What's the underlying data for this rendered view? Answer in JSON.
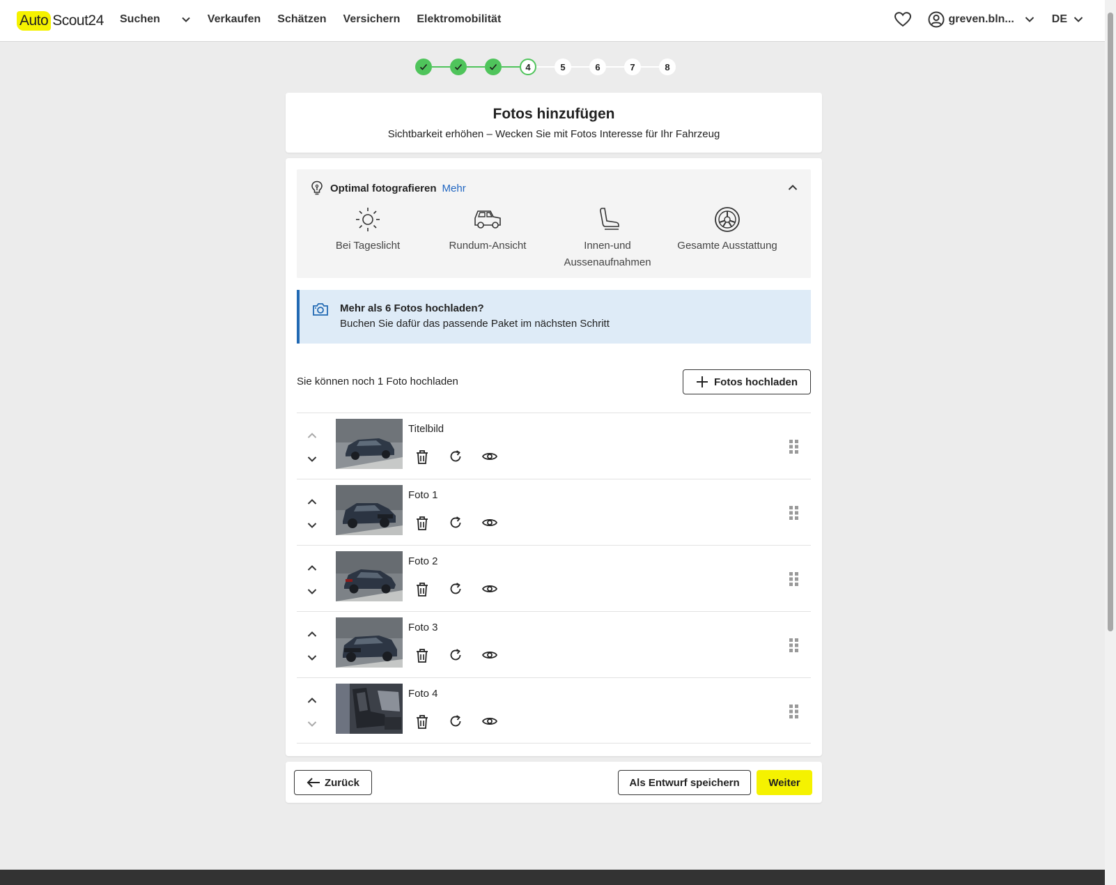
{
  "header": {
    "logo_auto": "Auto",
    "logo_scout": "Scout24",
    "nav": [
      "Suchen",
      "Verkaufen",
      "Schätzen",
      "Versichern",
      "Elektromobilität"
    ],
    "user": "greven.bln...",
    "language": "DE"
  },
  "stepper": {
    "steps": [
      "1",
      "2",
      "3",
      "4",
      "5",
      "6",
      "7",
      "8"
    ],
    "completed_count": 3,
    "current": 4
  },
  "title_card": {
    "title": "Fotos hinzufügen",
    "subtitle": "Sichtbarkeit erhöhen – Wecken Sie mit Fotos Interesse für Ihr Fahrzeug"
  },
  "tips": {
    "heading": "Optimal fotografieren",
    "more_link": "Mehr",
    "items": [
      {
        "icon": "sun-icon",
        "label": "Bei Tageslicht"
      },
      {
        "icon": "car-side-icon",
        "label": "Rundum-Ansicht"
      },
      {
        "icon": "car-seat-icon",
        "label": "Innen-und Aussenaufnahmen"
      },
      {
        "icon": "steering-wheel-icon",
        "label": "Gesamte Ausstattung"
      }
    ]
  },
  "info_box": {
    "title": "Mehr als 6 Fotos hochladen?",
    "text": "Buchen Sie dafür das passende Paket im nächsten Schritt"
  },
  "upload": {
    "remaining_text": "Sie können noch 1 Foto hochladen",
    "button_label": "Fotos hochladen"
  },
  "photos": [
    {
      "label": "Titelbild"
    },
    {
      "label": "Foto 1"
    },
    {
      "label": "Foto 2"
    },
    {
      "label": "Foto 3"
    },
    {
      "label": "Foto 4"
    }
  ],
  "footer_actions": {
    "back": "Zurück",
    "draft": "Als Entwurf speichern",
    "next": "Weiter"
  },
  "colors": {
    "brand_yellow": "#f5f200",
    "step_green": "#4fc45b",
    "link_blue": "#1f65c1",
    "info_bg": "#deebf7",
    "info_border": "#2169b3"
  }
}
